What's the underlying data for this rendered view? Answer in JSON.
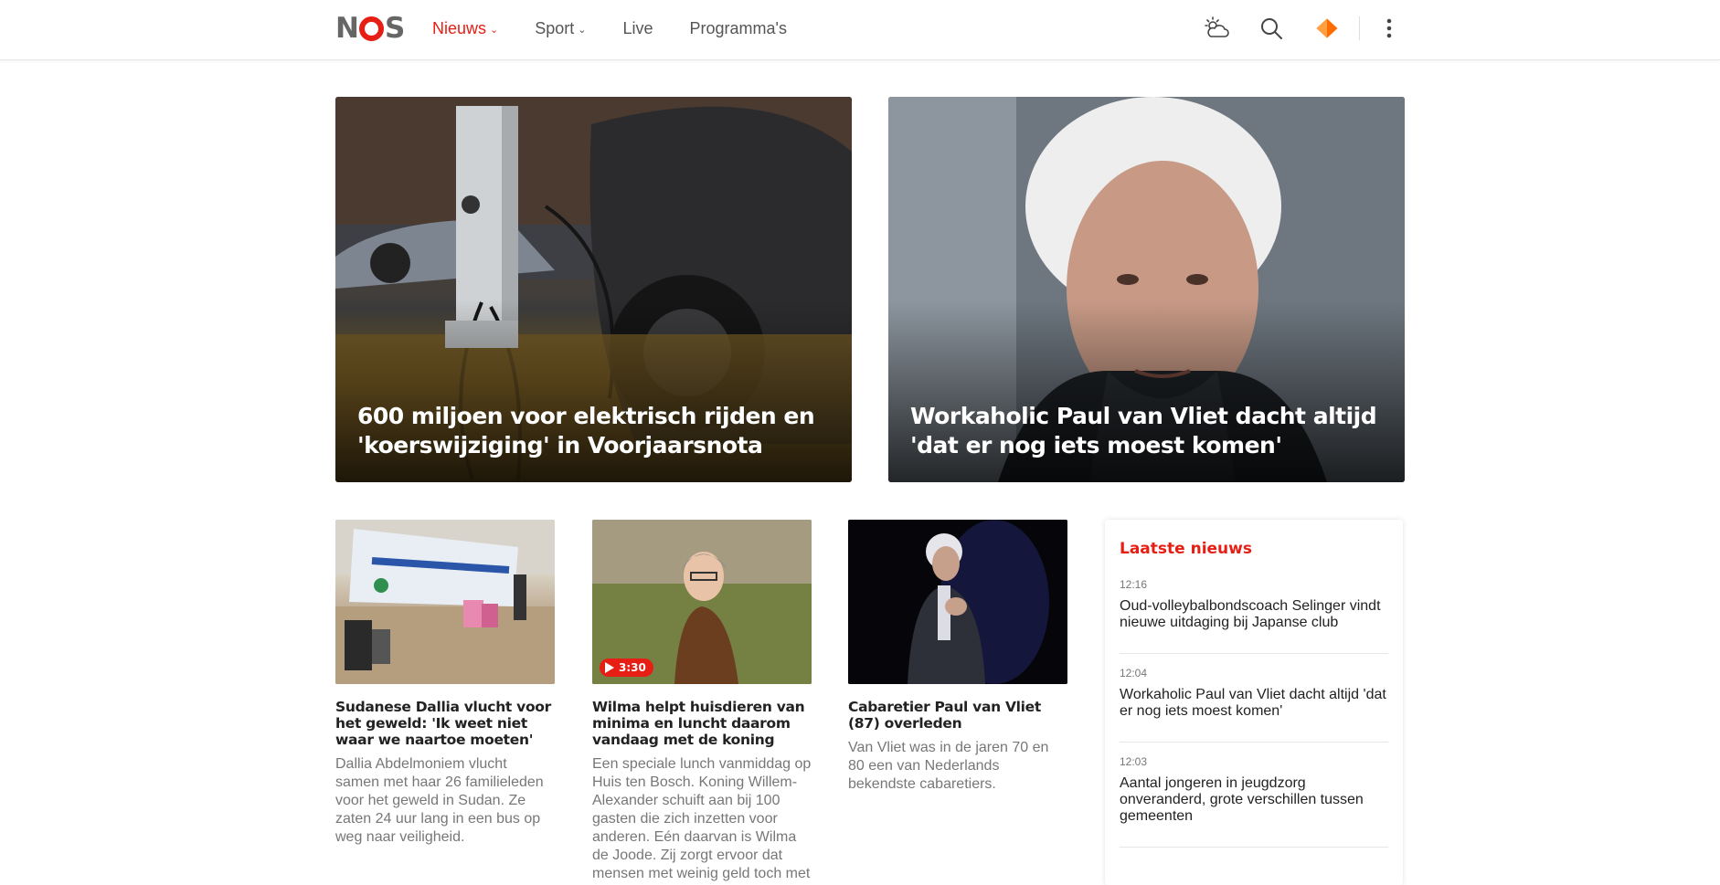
{
  "header": {
    "logo_text": "NOS",
    "nav": [
      {
        "label": "Nieuws",
        "has_dropdown": true,
        "active": true
      },
      {
        "label": "Sport",
        "has_dropdown": true,
        "active": false
      },
      {
        "label": "Live",
        "has_dropdown": false,
        "active": false
      },
      {
        "label": "Programma's",
        "has_dropdown": false,
        "active": false
      }
    ],
    "tools": [
      "weather-icon",
      "search-icon",
      "npo-start-icon",
      "more-menu-icon"
    ],
    "npo_label": "start"
  },
  "hero": [
    {
      "title": "600 miljoen voor elektrisch rijden en 'koerswijziging' in Voorjaarsnota"
    },
    {
      "title": "Workaholic Paul van Vliet dacht altijd 'dat er nog iets moest komen'"
    }
  ],
  "articles": [
    {
      "title": "Sudanese Dallia vlucht voor het geweld: 'Ik weet niet waar we naartoe moeten'",
      "summary": "Dallia Abdelmoniem vlucht samen met haar 26 familieleden voor het geweld in Sudan. Ze zaten 24 uur lang in een bus op weg naar veiligheid."
    },
    {
      "title": "Wilma helpt huisdieren van minima en luncht daarom vandaag met de koning",
      "summary": "Een speciale lunch vanmiddag op Huis ten Bosch. Koning Willem-Alexander schuift aan bij 100 gasten die zich inzetten voor anderen. Eén daarvan is Wilma de Joode. Zij zorgt ervoor dat mensen met weinig geld toch met",
      "video_duration": "3:30"
    },
    {
      "title": "Cabaretier Paul van Vliet (87) overleden",
      "summary": "Van Vliet was in de jaren 70 en 80 een van Nederlands bekendste cabaretiers."
    }
  ],
  "latest": {
    "heading": "Laatste nieuws",
    "items": [
      {
        "time": "12:16",
        "headline": "Oud-volleybalbondscoach Selinger vindt nieuwe uitdaging bij Japanse club"
      },
      {
        "time": "12:04",
        "headline": "Workaholic Paul van Vliet dacht altijd 'dat er nog iets moest komen'"
      },
      {
        "time": "12:03",
        "headline": "Aantal jongeren in jeugdzorg onveranderd, grote verschillen tussen gemeenten"
      }
    ]
  },
  "colors": {
    "accent": "#e61e14",
    "logo_gray": "#666666",
    "npo_orange": "#ff6d00"
  }
}
